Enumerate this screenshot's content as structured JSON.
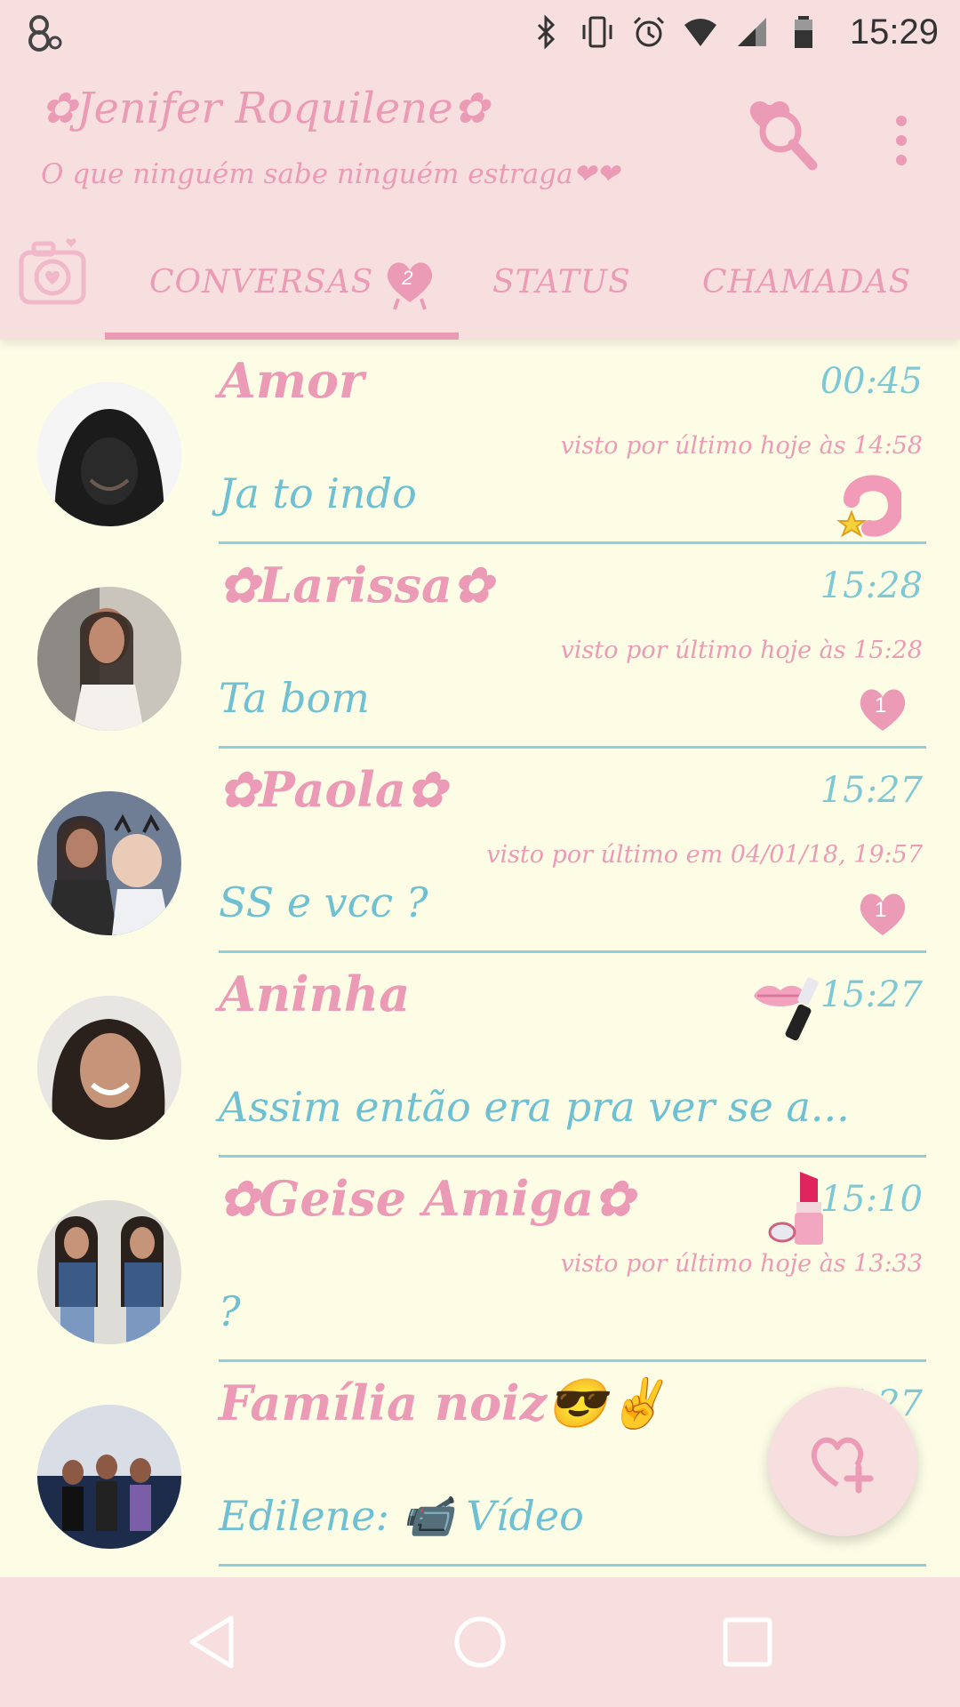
{
  "status_bar": {
    "time": "15:29",
    "icons": [
      "bluetooth-icon",
      "vibrate-icon",
      "alarm-icon",
      "wifi-icon",
      "signal-icon",
      "battery-icon"
    ]
  },
  "app_bar": {
    "title": "✿Jenifer Roquilene✿",
    "subtitle": "O que ninguém sabe ninguém estraga❤❤",
    "accent": "#ec9bb6",
    "background": "#f7dfe0"
  },
  "tabs": {
    "conversas": "CONVERSAS",
    "conversas_badge": "2",
    "status": "STATUS",
    "chamadas": "CHAMADAS"
  },
  "chats": [
    {
      "name": "Amor",
      "time": "00:45",
      "last_seen": "visto por último hoje às 14:58",
      "message": "Ja to indo",
      "indicator": "pink-ring-star-icon"
    },
    {
      "name": "✿Larissa✿",
      "time": "15:28",
      "last_seen": "visto por último hoje às 15:28",
      "message": "Ta bom",
      "unread": "1"
    },
    {
      "name": "✿Paola✿",
      "time": "15:27",
      "last_seen": "visto por último em 04/01/18, 19:57",
      "message": "SS e vcc ?",
      "unread": "1"
    },
    {
      "name": "Aninha",
      "time": "15:27",
      "last_seen": "",
      "message": "Assim então era pra ver se a...",
      "time_icon": "lips-lipstick-icon"
    },
    {
      "name": "✿Geise Amiga✿",
      "time": "15:10",
      "last_seen": "visto por último hoje às 13:33",
      "message": "?",
      "time_icon": "lipstick-icon"
    },
    {
      "name": "Família noiz😎✌",
      "time": "15:27",
      "last_seen": "",
      "message": "Edilene: 📹 Vídeo"
    }
  ],
  "colors": {
    "list_background": "#fdfde6",
    "message_text": "#6fc0d2",
    "divider": "#8fcfdc"
  }
}
